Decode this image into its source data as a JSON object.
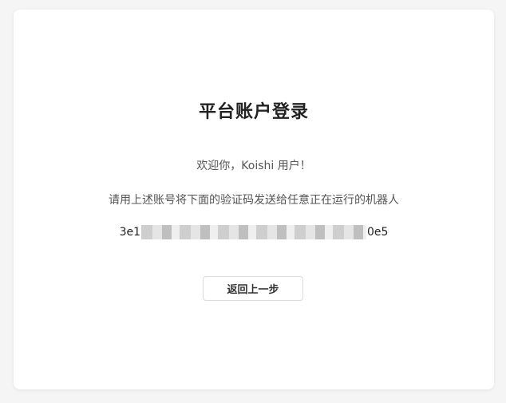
{
  "card": {
    "title": "平台账户登录",
    "welcome": "欢迎你，Koishi 用户！",
    "instruction": "请用上述账号将下面的验证码发送给任意正在运行的机器人",
    "code_prefix": "3e1",
    "code_suffix": "0e5",
    "back_label": "返回上一步"
  },
  "colors": {
    "background": "#f5f5f5",
    "card": "#ffffff",
    "title": "#222222",
    "body_text": "#555555"
  }
}
